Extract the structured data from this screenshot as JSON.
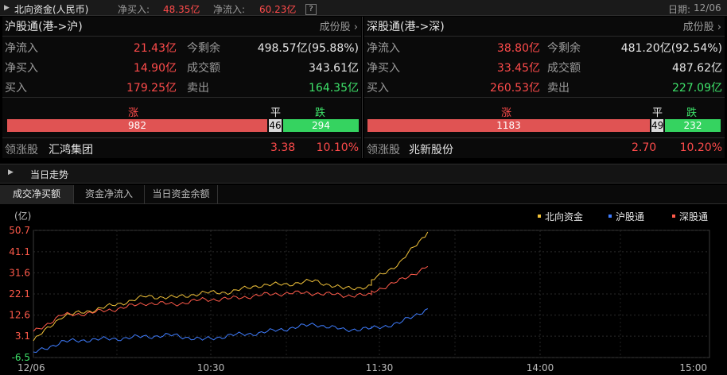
{
  "topbar": {
    "title": "北向资金(人民币)",
    "net_buy_label": "净买入:",
    "net_buy_value": "48.35亿",
    "net_inflow_label": "净流入:",
    "net_inflow_value": "60.23亿",
    "help": "?",
    "date_label": "日期:",
    "date_value": "12/06"
  },
  "sh": {
    "title": "沪股通(港->沪)",
    "dropdown": "成份股",
    "net_inflow_label": "净流入",
    "net_inflow": "21.43亿",
    "remaining_label": "今剩余",
    "remaining": "498.57亿(95.88%)",
    "net_buy_label": "净买入",
    "net_buy": "14.90亿",
    "turnover_label": "成交额",
    "turnover": "343.61亿",
    "buy_label": "买入",
    "buy": "179.25亿",
    "sell_label": "卖出",
    "sell": "164.35亿",
    "up_label": "涨",
    "flat_label": "平",
    "down_label": "跌",
    "up": 982,
    "flat": 46,
    "down": 294,
    "leader_label": "领涨股",
    "leader_name": "汇鸿集团",
    "leader_price": "3.38",
    "leader_pct": "10.10%"
  },
  "sz": {
    "title": "深股通(港->深)",
    "dropdown": "成份股",
    "net_inflow_label": "净流入",
    "net_inflow": "38.80亿",
    "remaining_label": "今剩余",
    "remaining": "481.20亿(92.54%)",
    "net_buy_label": "净买入",
    "net_buy": "33.45亿",
    "turnover_label": "成交额",
    "turnover": "487.62亿",
    "buy_label": "买入",
    "buy": "260.53亿",
    "sell_label": "卖出",
    "sell": "227.09亿",
    "up_label": "涨",
    "flat_label": "平",
    "down_label": "跌",
    "up": 1183,
    "flat": 49,
    "down": 232,
    "leader_label": "领涨股",
    "leader_name": "兆新股份",
    "leader_price": "2.70",
    "leader_pct": "10.20%"
  },
  "trend": {
    "title": "当日走势"
  },
  "tabs": [
    "成交净买额",
    "资金净流入",
    "当日资金余额"
  ],
  "colors": {
    "north": "#f2c33a",
    "sh": "#3f7dff",
    "sz": "#ff5a4a",
    "up": "#e05353",
    "down": "#35d360"
  },
  "chart_data": {
    "type": "line",
    "ylabel": "(亿)",
    "y_ticks": [
      50.7,
      41.1,
      31.6,
      22.1,
      12.6,
      3.1,
      -6.5
    ],
    "ylim": [
      -6.5,
      50.7
    ],
    "x_ticks": [
      "12/06",
      "10:30",
      "11:30",
      "14:00",
      "15:00"
    ],
    "x": [
      "09:30",
      "09:40",
      "09:50",
      "10:00",
      "10:10",
      "10:20",
      "10:30",
      "10:40",
      "10:50",
      "11:00",
      "11:10",
      "11:20",
      "11:30",
      "13:00",
      "13:10",
      "13:20"
    ],
    "series": [
      {
        "name": "北向资金",
        "values": [
          1.0,
          12.0,
          14.5,
          17.5,
          21.0,
          20.5,
          22.5,
          23.0,
          26.0,
          26.5,
          28.0,
          24.5,
          25.5,
          28.0,
          36.0,
          50.0
        ]
      },
      {
        "name": "沪股通",
        "values": [
          -4.5,
          0.5,
          1.5,
          2.0,
          3.0,
          3.5,
          1.5,
          3.5,
          4.5,
          6.5,
          8.5,
          6.0,
          6.5,
          6.5,
          9.0,
          15.5
        ]
      },
      {
        "name": "深股通",
        "values": [
          5.0,
          12.5,
          13.5,
          15.5,
          18.0,
          17.5,
          19.5,
          20.0,
          21.5,
          22.5,
          22.5,
          21.5,
          21.5,
          23.0,
          28.0,
          34.5
        ]
      }
    ]
  }
}
